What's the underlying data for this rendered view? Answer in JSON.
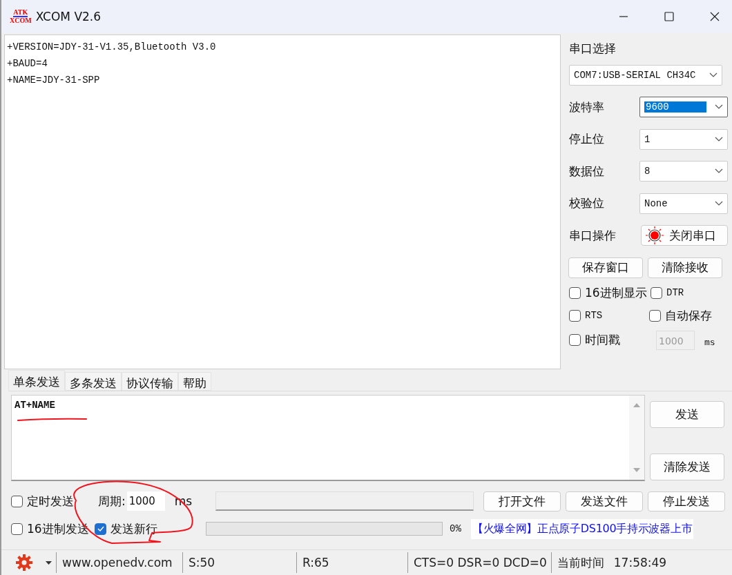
{
  "window": {
    "title": "XCOM V2.6",
    "logo_top": "ATK",
    "logo_bottom": "XCOM"
  },
  "receive_lines": [
    "+VERSION=JDY-31-V1.35,Bluetooth V3.0",
    "+BAUD=4",
    "+NAME=JDY-31-SPP"
  ],
  "port_panel": {
    "title": "串口选择",
    "port": "COM7:USB-SERIAL CH34C",
    "settings": [
      {
        "label": "波特率",
        "value": "9600",
        "selected": true
      },
      {
        "label": "停止位",
        "value": "1",
        "selected": false
      },
      {
        "label": "数据位",
        "value": "8",
        "selected": false
      },
      {
        "label": "校验位",
        "value": "None",
        "selected": false
      }
    ],
    "operation_label": "串口操作",
    "operation_button": "关闭串口",
    "port_open": true,
    "buttons": [
      "保存窗口",
      "清除接收"
    ],
    "options": [
      {
        "label": "16进制显示",
        "checked": false
      },
      {
        "label": "DTR",
        "checked": false
      },
      {
        "label": "RTS",
        "checked": false
      },
      {
        "label": "自动保存",
        "checked": false
      }
    ],
    "timestamp": {
      "label": "时间戳",
      "checked": false,
      "value": "1000",
      "disabled": true,
      "unit": "ms"
    }
  },
  "tabs": [
    {
      "label": "单条发送",
      "selected": true
    },
    {
      "label": "多条发送",
      "selected": false
    },
    {
      "label": "协议传输",
      "selected": false
    },
    {
      "label": "帮助",
      "selected": false
    }
  ],
  "send_text": "AT+NAME",
  "send_buttons": [
    "发送",
    "清除发送"
  ],
  "timed_send": {
    "label": "定时发送",
    "checked": false,
    "period_label": "周期:",
    "period": "1000",
    "unit": "ms"
  },
  "hex_send": {
    "label": "16进制发送",
    "checked": false
  },
  "send_newline": {
    "label": "发送新行",
    "checked": true
  },
  "file_buttons": [
    "打开文件",
    "发送文件",
    "停止发送"
  ],
  "progress": {
    "level": 0,
    "reading": "0%"
  },
  "ad_link": "【火爆全网】正点原子DS100手持示波器上市",
  "status_bar": {
    "url": "www.openedv.com",
    "sent": "S:50",
    "received": "R:65",
    "signals": "CTS=0 DSR=0 DCD=0",
    "time_label": "当前时间",
    "time": "17:58:49"
  }
}
